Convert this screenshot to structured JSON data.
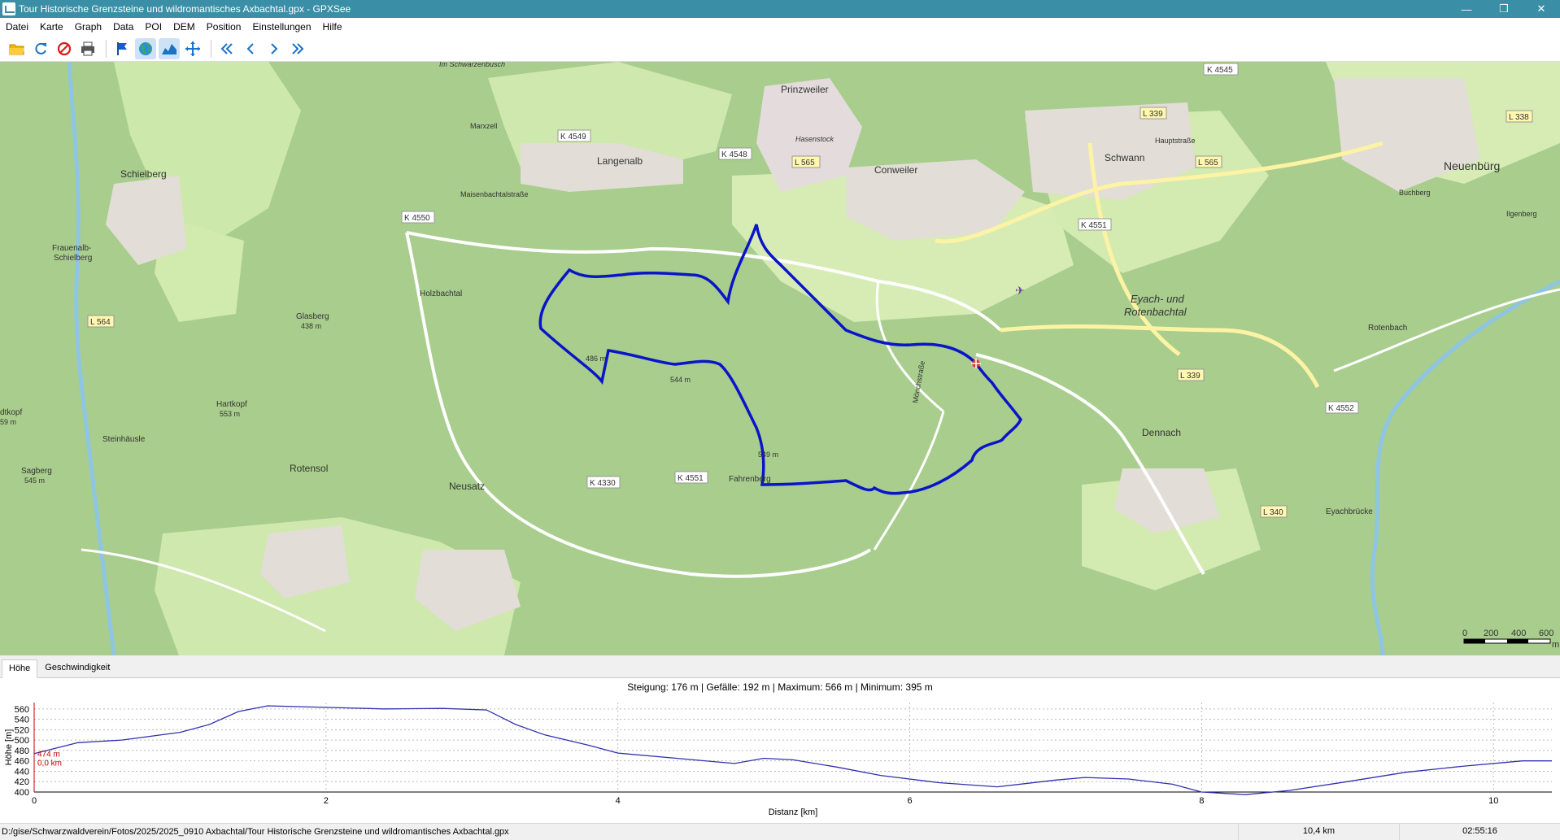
{
  "window": {
    "title": "Tour Historische Grenzsteine und wildromantisches Axbachtal.gpx - GPXSee",
    "minimize": "—",
    "maximize": "❐",
    "close": "✕"
  },
  "menu": [
    "Datei",
    "Karte",
    "Graph",
    "Data",
    "POI",
    "DEM",
    "Position",
    "Einstellungen",
    "Hilfe"
  ],
  "toolbar": {
    "icons": [
      "open-folder-icon",
      "reload-icon",
      "close-file-icon",
      "print-icon",
      "flag-icon",
      "globe-icon",
      "graph-icon",
      "crosshair-icon",
      "first-icon",
      "previous-icon",
      "next-icon",
      "last-icon"
    ],
    "colors": {
      "accent": "#1a73c7",
      "track": "#0a14c8"
    }
  },
  "map": {
    "labels": {
      "prinzweiler": "Prinzweiler",
      "im_schwarzenbusch": "Im Schwarzenbusch",
      "k4545": "K 4545",
      "l339_top": "L 339",
      "l338": "L 338",
      "neuenbuerg": "Neuenbürg",
      "schwann": "Schwann",
      "l565_right": "L 565",
      "hauptstrasse": "Hauptstraße",
      "hasenstock": "Hasenstock",
      "marxzell": "Marxzell",
      "k4549": "K 4549",
      "langenalb": "Langenalb",
      "k4548": "K 4548",
      "l565": "L 565",
      "conweiler": "Conweiler",
      "schielberg": "Schielberg",
      "maisenbachtalstrasse": "Maisenbachtalstraße",
      "k4550": "K 4550",
      "k4551_top": "K 4551",
      "buchberg": "Buchberg",
      "ilgenberg": "Ilgenberg",
      "frauenalb": "Frauenalb-",
      "schielberg2": "Schielberg",
      "holzbachtal": "Holzbachtal",
      "glasberg": "Glasberg",
      "glasberg_m": "438 m",
      "eyach1": "Eyach- und",
      "eyach2": "Rotenbachtal",
      "moenchstrasse": "Mönchstraße",
      "l564": "L 564",
      "hartkopf": "Hartkopf",
      "hartkopf_m": "553 m",
      "m486": "486 m",
      "m544": "544 m",
      "rotenbach": "Rotenbach",
      "l339_mid": "L 339",
      "steinhausle": "Steinhäusle",
      "k4552": "K 4552",
      "dennach": "Dennach",
      "rotensol": "Rotensol",
      "m549": "549 m",
      "sagberg": "Sagberg",
      "sagberg_m": "545 m",
      "neusatz": "Neusatz",
      "k4330": "K 4330",
      "k4551_bottom": "K 4551",
      "fahrenberg": "Fahrenberg",
      "l340": "L 340",
      "eyachbruecke": "Eyachbrücke",
      "kopf": "dtkopf",
      "kopf_m": "59 m",
      "scale": [
        "0",
        "200",
        "400",
        "600"
      ],
      "scale_unit": "m"
    }
  },
  "tabs": [
    "Höhe",
    "Geschwindigkeit"
  ],
  "graph": {
    "stats": "Steigung: 176 m | Gefälle: 192 m | Maximum: 566 m | Minimum: 395 m",
    "marker_elev": "474 m",
    "marker_dist": "0,0 km"
  },
  "chart_data": {
    "type": "line",
    "xlabel": "Distanz [km]",
    "ylabel": "Höhe [m]",
    "xlim": [
      0,
      10.4
    ],
    "ylim": [
      400,
      566
    ],
    "xticks": [
      "0",
      "2",
      "4",
      "6",
      "8",
      "10"
    ],
    "yticks": [
      "400",
      "420",
      "440",
      "460",
      "480",
      "500",
      "520",
      "540",
      "560"
    ],
    "series": [
      {
        "color": "#3030b0",
        "x": [
          0,
          0.3,
          0.6,
          1.0,
          1.2,
          1.4,
          1.6,
          2.0,
          2.4,
          2.8,
          3.1,
          3.3,
          3.5,
          3.8,
          4.0,
          4.4,
          4.8,
          5.0,
          5.2,
          5.5,
          5.8,
          6.2,
          6.6,
          7.0,
          7.2,
          7.5,
          7.8,
          8.0,
          8.3,
          8.6,
          9.0,
          9.4,
          9.8,
          10.2,
          10.4
        ],
        "y": [
          474,
          495,
          500,
          515,
          530,
          555,
          566,
          563,
          560,
          561,
          558,
          530,
          510,
          490,
          475,
          465,
          455,
          465,
          462,
          448,
          432,
          418,
          410,
          423,
          428,
          425,
          415,
          400,
          395,
          403,
          420,
          438,
          450,
          460,
          460
        ]
      }
    ]
  },
  "status": {
    "path": "D:/gise/Schwarzwaldverein/Fotos/2025/2025_0910 Axbachtal/Tour Historische Grenzsteine und wildromantisches Axbachtal.gpx",
    "distance": "10,4 km",
    "time": "02:55:16"
  }
}
